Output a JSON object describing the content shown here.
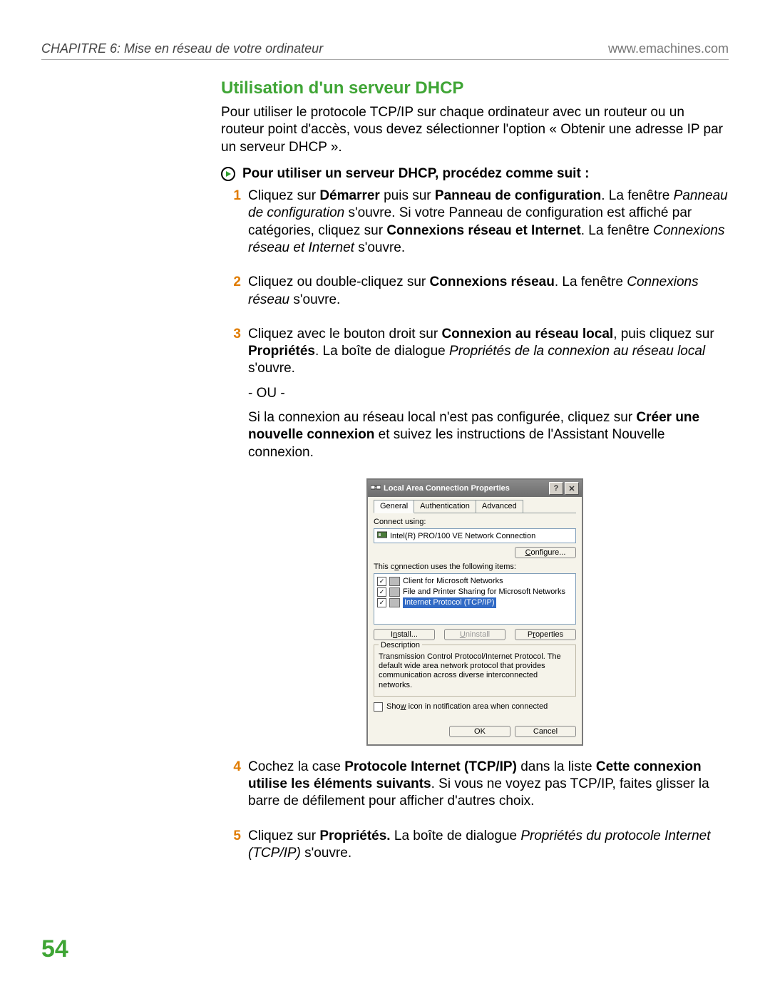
{
  "header": {
    "chapter": "CHAPITRE 6: Mise en réseau de votre ordinateur",
    "url": "www.emachines.com"
  },
  "section_title": "Utilisation d'un serveur DHCP",
  "intro": "Pour utiliser le protocole TCP/IP sur chaque ordinateur avec un routeur ou un routeur point d'accès, vous devez sélectionner l'option « Obtenir une adresse IP par un serveur DHCP ».",
  "proc_title": "Pour utiliser un serveur DHCP, procédez comme suit :",
  "steps": {
    "s1": {
      "num": "1",
      "p1a": "Cliquez sur ",
      "b1": "Démarrer",
      "p1b": " puis sur ",
      "b2": "Panneau de configuration",
      "p1c": ". La fenêtre ",
      "i1": "Panneau de configuration",
      "p1d": " s'ouvre. Si votre Panneau de configuration est affiché par catégories, cliquez sur ",
      "b3": "Connexions réseau et Internet",
      "p1e": ". La fenêtre ",
      "i2": "Connexions réseau et Internet",
      "p1f": " s'ouvre."
    },
    "s2": {
      "num": "2",
      "p1a": "Cliquez ou double-cliquez sur ",
      "b1": "Connexions réseau",
      "p1b": ". La fenêtre ",
      "i1": "Connexions réseau",
      "p1c": " s'ouvre."
    },
    "s3": {
      "num": "3",
      "p1a": "Cliquez avec le bouton droit sur ",
      "b1": "Connexion au réseau local",
      "p1b": ", puis cliquez sur ",
      "b2": "Propriétés",
      "p1c": ". La boîte de dialogue ",
      "i1": "Propriétés de la connexion au réseau local",
      "p1d": " s'ouvre.",
      "or": "- OU -",
      "p2a": "Si la connexion au réseau local n'est pas configurée, cliquez sur ",
      "b3": "Créer une nouvelle connexion",
      "p2b": " et suivez les instructions de l'Assistant Nouvelle connexion."
    },
    "s4": {
      "num": "4",
      "p1a": "Cochez la case ",
      "b1": "Protocole Internet (TCP/IP)",
      "p1b": " dans la liste ",
      "b2": "Cette connexion utilise les éléments suivants",
      "p1c": ". Si vous ne voyez pas TCP/IP, faites glisser la barre de défilement pour afficher d'autres choix."
    },
    "s5": {
      "num": "5",
      "p1a": "Cliquez sur ",
      "b1": "Propriétés.",
      "p1b": " La boîte de dialogue ",
      "i1": "Propriétés du protocole Internet (TCP/IP)",
      "p1c": " s'ouvre."
    }
  },
  "dialog": {
    "title": "Local Area Connection Properties",
    "tabs": {
      "general": "General",
      "auth": "Authentication",
      "adv": "Advanced"
    },
    "connect_using_label": "Connect using:",
    "adapter": "Intel(R) PRO/100 VE Network Connection",
    "configure": "Configure...",
    "items_label": "This connection uses the following items:",
    "items": {
      "i0": "Client for Microsoft Networks",
      "i1": "File and Printer Sharing for Microsoft Networks",
      "i2": "Internet Protocol (TCP/IP)"
    },
    "install": "Install...",
    "uninstall": "Uninstall",
    "properties": "Properties",
    "desc_title": "Description",
    "desc_text": "Transmission Control Protocol/Internet Protocol. The default wide area network protocol that provides communication across diverse interconnected networks.",
    "show_icon": "Show icon in notification area when connected",
    "ok": "OK",
    "cancel": "Cancel"
  },
  "page_number": "54"
}
